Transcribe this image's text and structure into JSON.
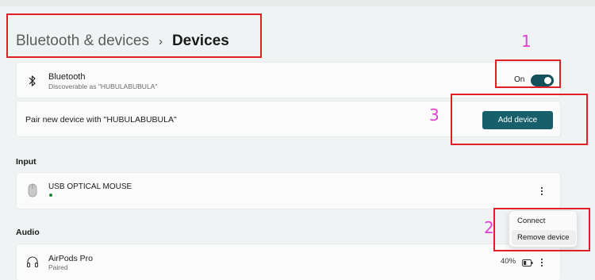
{
  "breadcrumb": {
    "parent": "Bluetooth & devices",
    "separator": "›",
    "current": "Devices"
  },
  "bluetooth": {
    "icon": "bluetooth-icon",
    "title": "Bluetooth",
    "subtitle": "Discoverable as \"HUBULABUBULA\"",
    "toggle_label": "On",
    "toggle_on": true
  },
  "pair": {
    "text": "Pair new device with \"HUBULABUBULA\"",
    "button_label": "Add device"
  },
  "sections": {
    "input": "Input",
    "audio": "Audio"
  },
  "input_device": {
    "icon": "mouse-icon",
    "name": "USB OPTICAL MOUSE",
    "status_color": "#1b8a3a"
  },
  "audio_device": {
    "icon": "headphones-icon",
    "name": "AirPods Pro",
    "status": "Paired",
    "battery": "40%",
    "battery_level": 0.4
  },
  "context_menu": {
    "connect": "Connect",
    "remove": "Remove device"
  },
  "annotations": {
    "toggle": "1",
    "menu": "2",
    "add_device": "3",
    "color": "#e21f26",
    "number_color": "#e040d8"
  },
  "colors": {
    "accent": "#17606b",
    "toggle": "#14515c",
    "background": "#eff3f3"
  }
}
